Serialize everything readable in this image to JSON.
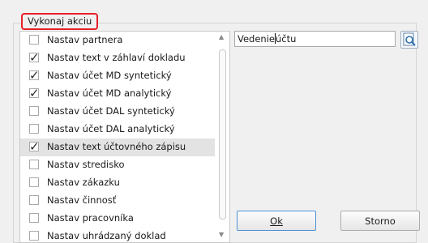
{
  "group_title": "Vykonaj akciu",
  "actions": [
    {
      "label": "Nastav partnera",
      "checked": false
    },
    {
      "label": "Nastav text v záhlaví dokladu",
      "checked": true
    },
    {
      "label": "Nastav účet MD syntetický",
      "checked": true
    },
    {
      "label": "Nastav účet MD analytický",
      "checked": true
    },
    {
      "label": "Nastav účet DAL syntetický",
      "checked": false
    },
    {
      "label": "Nastav účet DAL analytický",
      "checked": false
    },
    {
      "label": "Nastav text účtovného zápisu",
      "checked": true,
      "selected": true
    },
    {
      "label": "Nastav stredisko",
      "checked": false
    },
    {
      "label": "Nastav zákazku",
      "checked": false
    },
    {
      "label": "Nastav činnosť",
      "checked": false
    },
    {
      "label": "Nastav pracovníka",
      "checked": false
    },
    {
      "label": "Nastav uhrádzaný doklad",
      "checked": false
    }
  ],
  "text_field": {
    "before_caret": "Vedenie",
    "after_caret": "účtu"
  },
  "icons": {
    "lookup": "search-lookup-icon",
    "scroll_up": "scroll-up-icon",
    "scroll_down": "scroll-down-icon"
  },
  "buttons": {
    "ok_label": "Ok",
    "cancel_label": "Storno"
  }
}
